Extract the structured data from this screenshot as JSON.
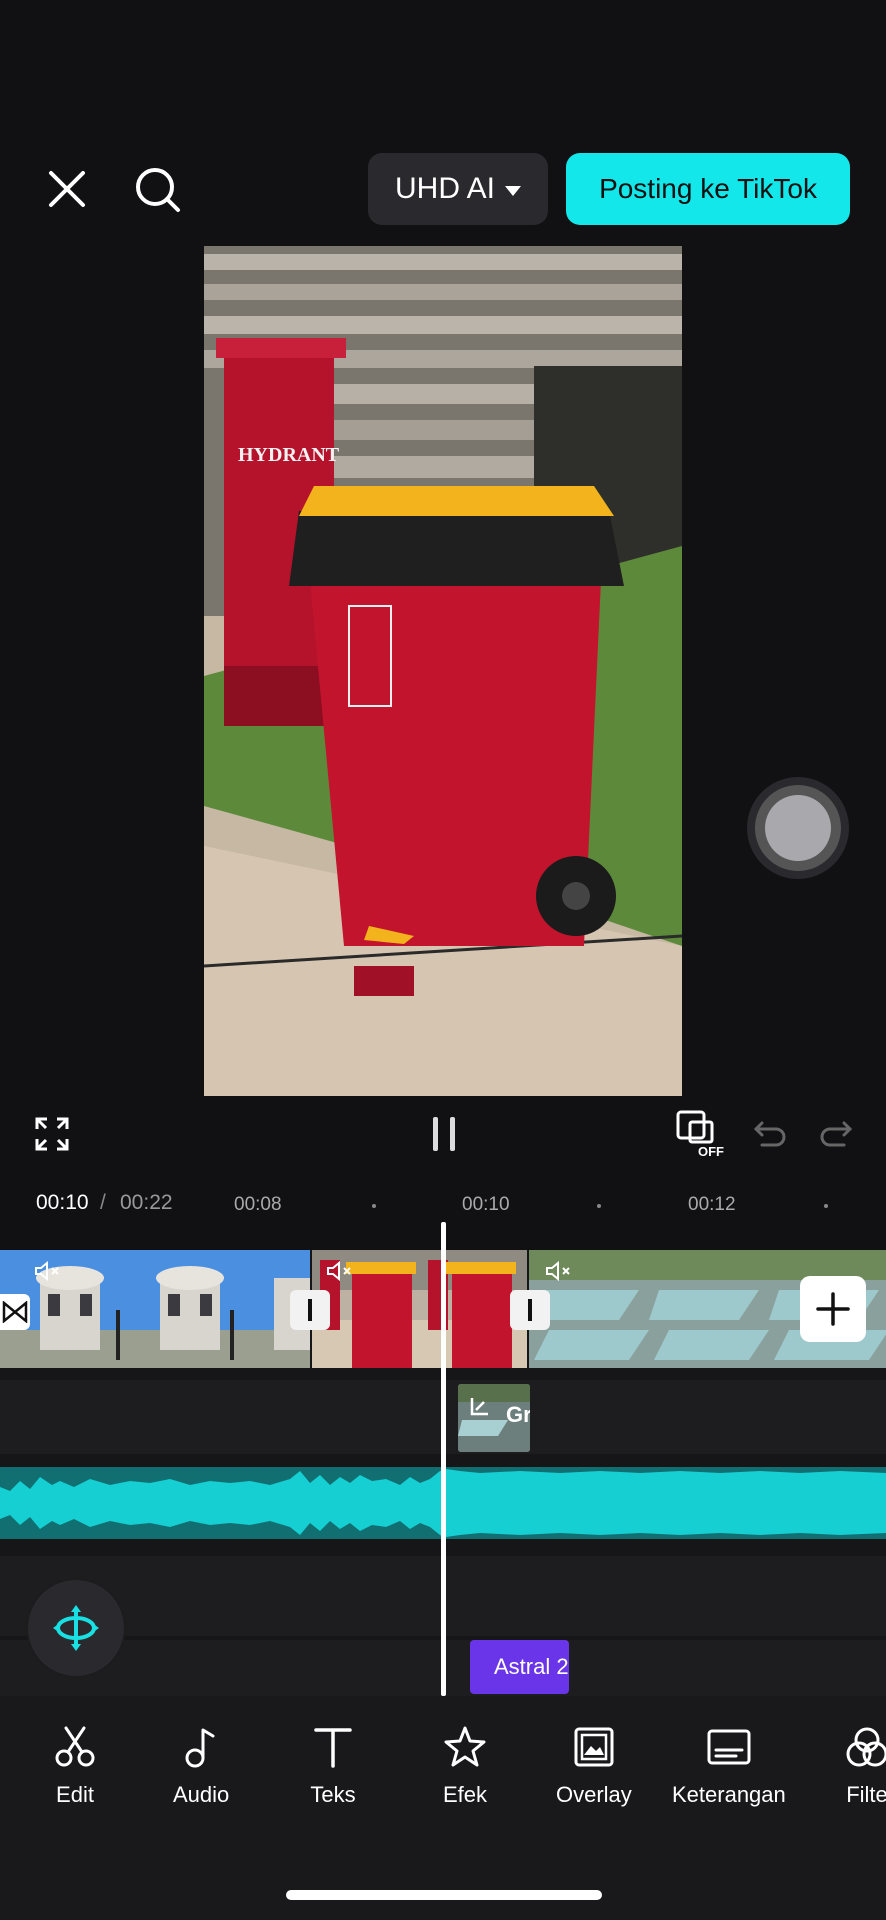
{
  "topbar": {
    "quality_label": "UHD AI",
    "post_label": "Posting ke TikTok"
  },
  "playback": {
    "current_time": "00:10",
    "separator": "/",
    "total_time": "00:22",
    "snap_state": "OFF"
  },
  "ruler": {
    "ticks": [
      "00:08",
      "00:10",
      "00:12"
    ]
  },
  "timeline": {
    "overlay_clip_label": "Gr",
    "effect_clip_label": "Astral 2"
  },
  "toolbar": {
    "items": [
      {
        "label": "Edit",
        "icon": "scissors-icon"
      },
      {
        "label": "Audio",
        "icon": "music-note-icon"
      },
      {
        "label": "Teks",
        "icon": "text-icon"
      },
      {
        "label": "Efek",
        "icon": "effects-star-icon"
      },
      {
        "label": "Overlay",
        "icon": "overlay-icon"
      },
      {
        "label": "Keterangan",
        "icon": "captions-icon"
      },
      {
        "label": "Filte",
        "icon": "filter-icon"
      }
    ]
  },
  "colors": {
    "accent": "#13e7ea",
    "audio_track": "#116f72",
    "effect_clip": "#6a35e8",
    "background": "#111114"
  }
}
